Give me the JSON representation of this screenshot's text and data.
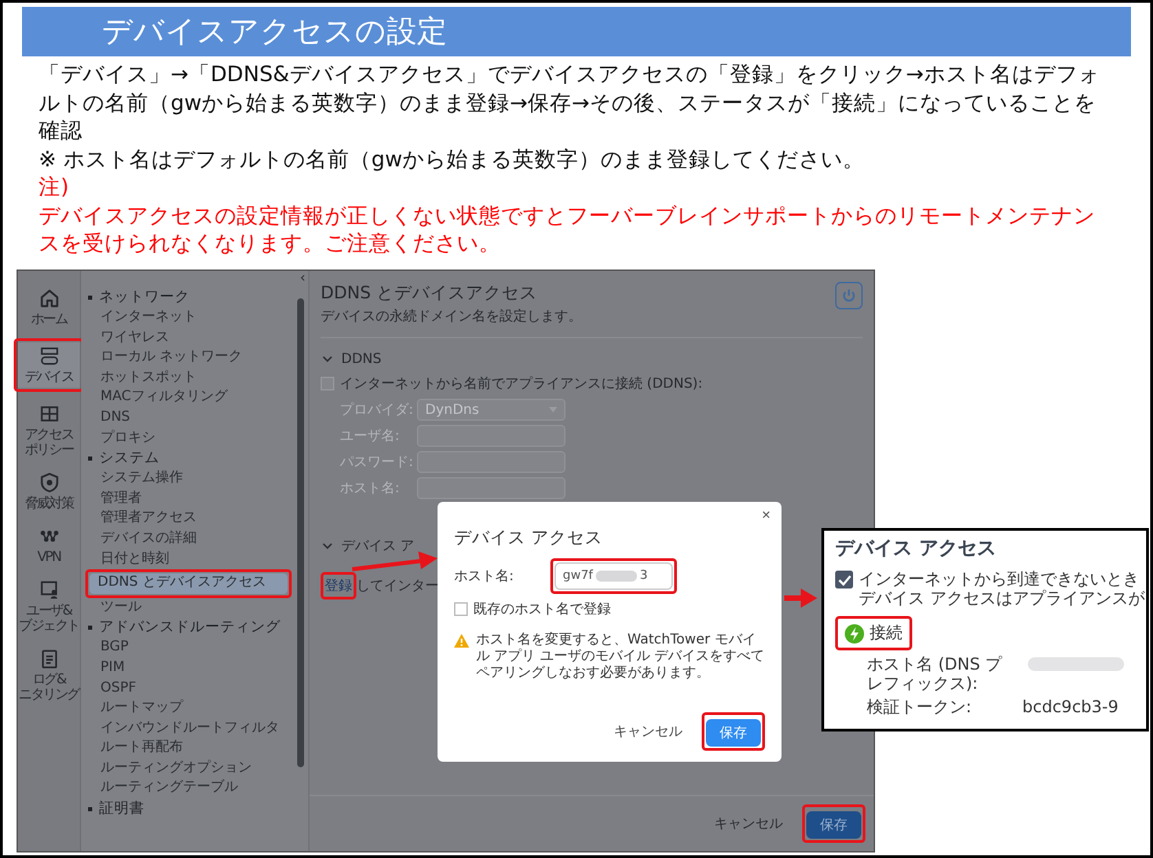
{
  "slide": {
    "title": "デバイスアクセスの設定",
    "instructions": [
      {
        "kind": "text",
        "text": "「デバイス」→「DDNS&デバイスアクセス」でデバイスアクセスの「登録」をクリック→ホスト名はデフォルトの名前（gwから始まる英数字）のまま登録→保存→その後、ステータスが「接続」になっていることを確認"
      },
      {
        "kind": "text",
        "text": "※ ホスト名はデフォルトの名前（gwから始まる英数字）のまま登録してください。"
      },
      {
        "kind": "warning",
        "text": "注)"
      },
      {
        "kind": "warning",
        "text": "デバイスアクセスの設定情報が正しくない状態ですとフーバーブレインサポートからのリモートメンテナンスを受けられなくなります。ご注意ください。"
      }
    ]
  },
  "screenshot": {
    "rail": [
      {
        "label_lines": [
          "ホーム"
        ],
        "selected": false,
        "callout": false
      },
      {
        "label_lines": [
          "デバイス"
        ],
        "selected": true,
        "callout": true
      },
      {
        "label_lines": [
          "アクセス",
          "ポリシー"
        ],
        "selected": false,
        "callout": false
      },
      {
        "label_lines": [
          "脅威対策"
        ],
        "selected": false,
        "callout": false
      },
      {
        "label_lines": [
          "VPN"
        ],
        "selected": false,
        "callout": false
      },
      {
        "label_lines": [
          "ユーザ&",
          "ブジェクト"
        ],
        "selected": false,
        "callout": false
      },
      {
        "label_lines": [
          "ログ&",
          "ニタリング"
        ],
        "selected": false,
        "callout": false
      }
    ],
    "nav": {
      "collapse": "‹",
      "groups": [
        {
          "label": "ネットワーク",
          "children": [
            {
              "label": "インターネット",
              "selected": false,
              "callout": false
            },
            {
              "label": "ワイヤレス",
              "selected": false,
              "callout": false
            },
            {
              "label": "ローカル ネットワーク",
              "selected": false,
              "callout": false
            },
            {
              "label": "ホットスポット",
              "selected": false,
              "callout": false
            },
            {
              "label": "MACフィルタリング",
              "selected": false,
              "callout": false
            },
            {
              "label": "DNS",
              "selected": false,
              "callout": false
            },
            {
              "label": "プロキシ",
              "selected": false,
              "callout": false
            }
          ]
        },
        {
          "label": "システム",
          "children": [
            {
              "label": "システム操作",
              "selected": false,
              "callout": false
            },
            {
              "label": "管理者",
              "selected": false,
              "callout": false
            },
            {
              "label": "管理者アクセス",
              "selected": false,
              "callout": false
            },
            {
              "label": "デバイスの詳細",
              "selected": false,
              "callout": false
            },
            {
              "label": "日付と時刻",
              "selected": false,
              "callout": false
            },
            {
              "label": "DDNS とデバイスアクセス",
              "selected": true,
              "callout": true
            },
            {
              "label": "ツール",
              "selected": false,
              "callout": false
            }
          ]
        },
        {
          "label": "アドバンスドルーティング",
          "children": [
            {
              "label": "BGP",
              "selected": false,
              "callout": false
            },
            {
              "label": "PIM",
              "selected": false,
              "callout": false
            },
            {
              "label": "OSPF",
              "selected": false,
              "callout": false
            },
            {
              "label": "ルートマップ",
              "selected": false,
              "callout": false
            },
            {
              "label": "インバウンドルートフィルタ",
              "selected": false,
              "callout": false
            },
            {
              "label": "ルート再配布",
              "selected": false,
              "callout": false
            },
            {
              "label": "ルーティングオプション",
              "selected": false,
              "callout": false
            },
            {
              "label": "ルーティングテーブル",
              "selected": false,
              "callout": false
            }
          ]
        },
        {
          "label": "証明書"
        }
      ]
    },
    "page": {
      "title": "DDNS とデバイスアクセス",
      "subtitle": "デバイスの永続ドメイン名を設定します。",
      "ddns": {
        "heading": "DDNS",
        "checkbox": {
          "label": "インターネットから名前でアプライアンスに接続 (DDNS):",
          "checked": false
        },
        "fields": [
          {
            "kind": "select",
            "label": "プロバイダ:",
            "value": "DynDns"
          },
          {
            "kind": "text",
            "label": "ユーザ名:"
          },
          {
            "kind": "text",
            "label": "パスワード:"
          },
          {
            "kind": "text",
            "label": "ホスト名:"
          }
        ]
      },
      "device_access": {
        "heading": "デバイス ア",
        "link": "登録",
        "link_callout": true,
        "rest": "してインター"
      },
      "cancel": "キャンセル",
      "save": "保存",
      "save_callout": true
    },
    "dialog": {
      "title": "デバイス アクセス",
      "close": "×",
      "host_label": "ホスト名:",
      "host_value_start": "gw7f",
      "host_value_end": "3",
      "host_callout": true,
      "checkbox": {
        "label": "既存のホスト名で登録",
        "checked": false
      },
      "warning": "ホスト名を変更すると、WatchTower モバイル アプリ ユーザのモバイル デバイスをすべてペアリングしなおす必要があります。",
      "cancel": "キャンセル",
      "save": "保存",
      "save_callout": true
    }
  },
  "inset": {
    "title": "デバイス アクセス",
    "checkbox": {
      "checked": true,
      "lines": [
        "インターネットから到達できないとき",
        "デバイス アクセスはアプライアンスが"
      ]
    },
    "status": "接続",
    "status_callout": true,
    "host_label": "ホスト名 (DNS プレフィックス):",
    "token_label": "検証トークン:",
    "token_value": "bcdc9cb3-9"
  }
}
